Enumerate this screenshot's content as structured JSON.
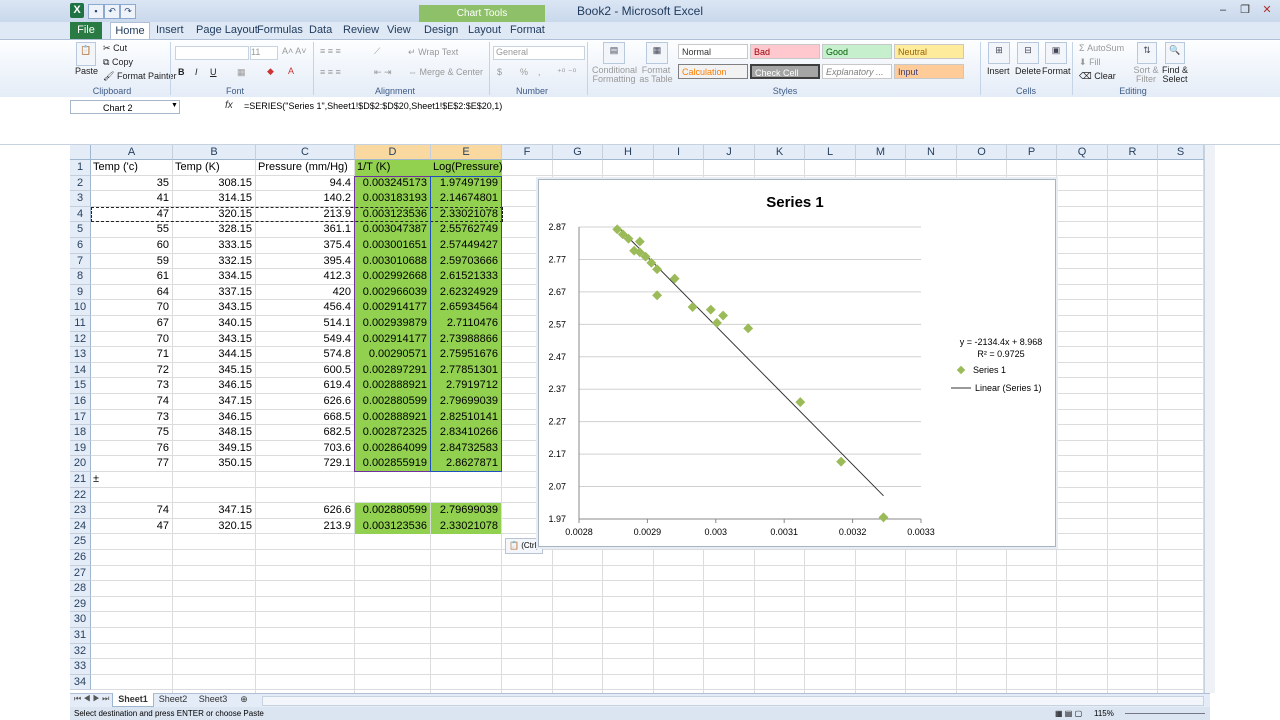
{
  "app": {
    "title": "Book2 - Microsoft Excel",
    "chart_tools_label": "Chart Tools",
    "tabs": [
      "File",
      "Home",
      "Insert",
      "Page Layout",
      "Formulas",
      "Data",
      "Review",
      "View",
      "Design",
      "Layout",
      "Format"
    ]
  },
  "ribbon": {
    "clipboard": {
      "label": "Clipboard",
      "paste": "Paste",
      "cut": "Cut",
      "copy": "Copy",
      "format_painter": "Format Painter"
    },
    "font": {
      "label": "Font",
      "size": "11",
      "bold": "B",
      "italic": "I",
      "underline": "U"
    },
    "alignment": {
      "label": "Alignment",
      "wrap_text": "Wrap Text",
      "merge_center": "Merge & Center"
    },
    "number": {
      "label": "Number",
      "format": "General",
      "currency": "$",
      "percent": "%",
      "comma": ","
    },
    "styles": {
      "label": "Styles",
      "conditional": "Conditional Formatting",
      "format_table": "Format as Table",
      "normal": "Normal",
      "bad": "Bad",
      "good": "Good",
      "neutral": "Neutral",
      "calculation": "Calculation",
      "check_cell": "Check Cell",
      "explanatory": "Explanatory ...",
      "input": "Input"
    },
    "cells": {
      "label": "Cells",
      "insert": "Insert",
      "delete": "Delete",
      "format": "Format"
    },
    "editing": {
      "label": "Editing",
      "autosum": "AutoSum",
      "fill": "Fill",
      "clear": "Clear",
      "sort_filter": "Sort & Filter",
      "find_select": "Find & Select"
    }
  },
  "formula_bar": {
    "name_box": "Chart 2",
    "fx": "fx",
    "formula": "=SERIES(\"Series 1\",Sheet1!$D$2:$D$20,Sheet1!$E$2:$E$20,1)"
  },
  "grid": {
    "columns": [
      "A",
      "B",
      "C",
      "D",
      "E",
      "F",
      "G",
      "H",
      "I",
      "J",
      "K",
      "L",
      "M",
      "N",
      "O",
      "P",
      "Q",
      "R",
      "S"
    ],
    "row_numbers": [
      "1",
      "2",
      "3",
      "4",
      "5",
      "6",
      "7",
      "8",
      "9",
      "10",
      "11",
      "12",
      "13",
      "14",
      "15",
      "16",
      "17",
      "18",
      "19",
      "20",
      "21",
      "22",
      "23",
      "24",
      "25",
      "26",
      "27",
      "28",
      "29",
      "30",
      "31",
      "32",
      "33",
      "34"
    ],
    "headers": [
      "Temp ('c)",
      "Temp (K)",
      "Pressure (mm/Hg)",
      "1/T (K)",
      "Log(Pressure)"
    ],
    "rows": [
      [
        "35",
        "308.15",
        "94.4",
        "0.003245173",
        "1.97497199"
      ],
      [
        "41",
        "314.15",
        "140.2",
        "0.003183193",
        "2.14674801"
      ],
      [
        "47",
        "320.15",
        "213.9",
        "0.003123536",
        "2.33021078"
      ],
      [
        "55",
        "328.15",
        "361.1",
        "0.003047387",
        "2.55762749"
      ],
      [
        "60",
        "333.15",
        "375.4",
        "0.003001651",
        "2.57449427"
      ],
      [
        "59",
        "332.15",
        "395.4",
        "0.003010688",
        "2.59703666"
      ],
      [
        "61",
        "334.15",
        "412.3",
        "0.002992668",
        "2.61521333"
      ],
      [
        "64",
        "337.15",
        "420",
        "0.002966039",
        "2.62324929"
      ],
      [
        "70",
        "343.15",
        "456.4",
        "0.002914177",
        "2.65934564"
      ],
      [
        "67",
        "340.15",
        "514.1",
        "0.002939879",
        "2.7110476"
      ],
      [
        "70",
        "343.15",
        "549.4",
        "0.002914177",
        "2.73988866"
      ],
      [
        "71",
        "344.15",
        "574.8",
        "0.00290571",
        "2.75951676"
      ],
      [
        "72",
        "345.15",
        "600.5",
        "0.002897291",
        "2.77851301"
      ],
      [
        "73",
        "346.15",
        "619.4",
        "0.002888921",
        "2.7919712"
      ],
      [
        "74",
        "347.15",
        "626.6",
        "0.002880599",
        "2.79699039"
      ],
      [
        "73",
        "346.15",
        "668.5",
        "0.002888921",
        "2.82510141"
      ],
      [
        "75",
        "348.15",
        "682.5",
        "0.002872325",
        "2.83410266"
      ],
      [
        "76",
        "349.15",
        "703.6",
        "0.002864099",
        "2.84732583"
      ],
      [
        "77",
        "350.15",
        "729.1",
        "0.002855919",
        "2.8627871"
      ]
    ],
    "row21_marker": "±",
    "extra_rows": [
      [
        "74",
        "347.15",
        "626.6",
        "0.002880599",
        "2.79699039"
      ],
      [
        "47",
        "320.15",
        "213.9",
        "0.003123536",
        "2.33021078"
      ]
    ],
    "paste_options": "(Ctrl)"
  },
  "chart_data": {
    "type": "scatter",
    "title": "Series 1",
    "xlim": [
      0.0028,
      0.0033
    ],
    "ylim": [
      1.97,
      2.87
    ],
    "x_ticks": [
      "0.0028",
      "0.0029",
      "0.003",
      "0.0031",
      "0.0032",
      "0.0033"
    ],
    "y_ticks": [
      "1.97",
      "2.07",
      "2.17",
      "2.27",
      "2.37",
      "2.47",
      "2.57",
      "2.67",
      "2.77",
      "2.87"
    ],
    "grid": true,
    "legend_position": "right",
    "series": [
      {
        "name": "Series 1",
        "x": [
          0.003245173,
          0.003183193,
          0.003123536,
          0.003047387,
          0.003001651,
          0.003010688,
          0.002992668,
          0.002966039,
          0.002914177,
          0.002939879,
          0.002914177,
          0.00290571,
          0.002897291,
          0.002888921,
          0.002880599,
          0.002888921,
          0.002872325,
          0.002864099,
          0.002855919
        ],
        "y": [
          1.97497199,
          2.14674801,
          2.33021078,
          2.55762749,
          2.57449427,
          2.59703666,
          2.61521333,
          2.62324929,
          2.65934564,
          2.7110476,
          2.73988866,
          2.75951676,
          2.77851301,
          2.7919712,
          2.79699039,
          2.82510141,
          2.83410266,
          2.84732583,
          2.8627871
        ],
        "color": "#9bbb59"
      }
    ],
    "trendline": {
      "name": "Linear (Series 1)",
      "slope": -2134.4,
      "intercept": 8.968,
      "x_range": [
        0.0028559,
        0.0032452
      ],
      "equation": "y = -2134.4x  + 8.968",
      "r2": "R² = 0.9725"
    }
  },
  "sheets": {
    "tabs": [
      "Sheet1",
      "Sheet2",
      "Sheet3"
    ],
    "active": "Sheet1"
  },
  "status": {
    "message": "Select destination and press ENTER or choose Paste",
    "zoom": "115%"
  }
}
